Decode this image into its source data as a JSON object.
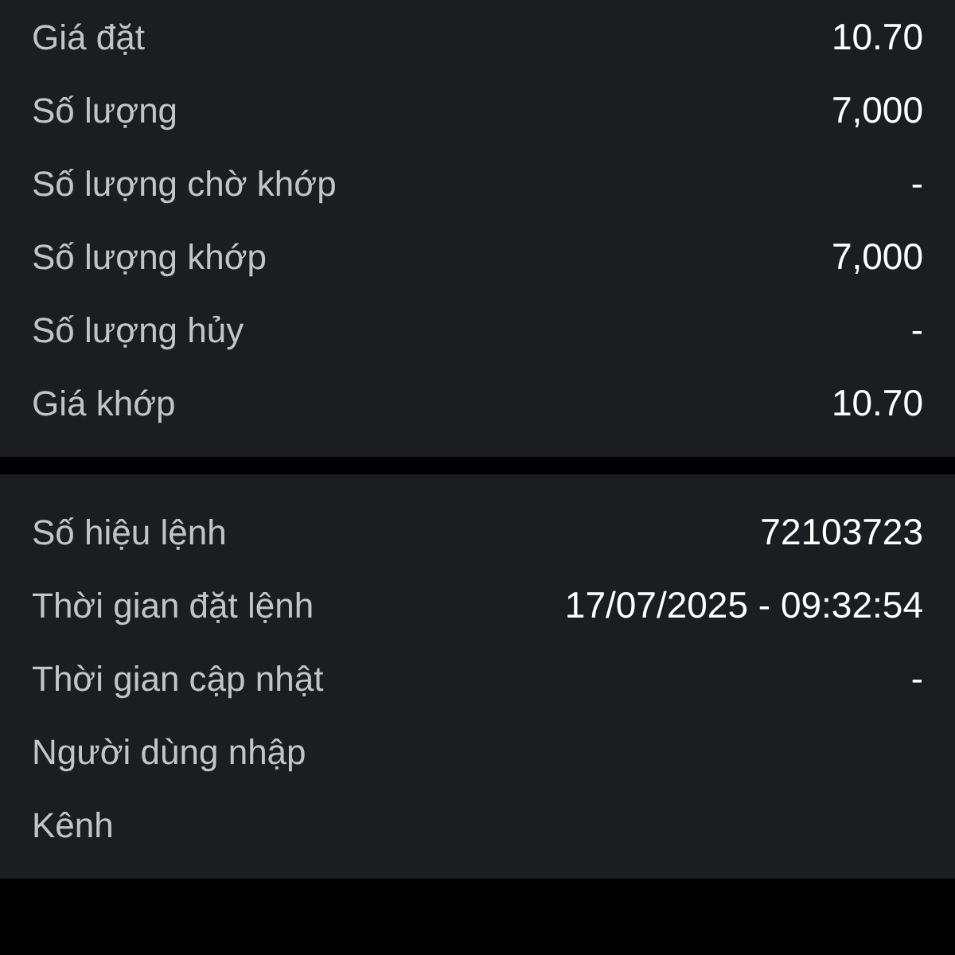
{
  "sections": [
    {
      "rows": [
        {
          "label": "Giá đặt",
          "value": "10.70"
        },
        {
          "label": "Số lượng",
          "value": "7,000"
        },
        {
          "label": "Số lượng chờ khớp",
          "value": "-"
        },
        {
          "label": "Số lượng khớp",
          "value": "7,000"
        },
        {
          "label": "Số lượng hủy",
          "value": "-"
        },
        {
          "label": "Giá khớp",
          "value": "10.70"
        }
      ]
    },
    {
      "rows": [
        {
          "label": "Số hiệu lệnh",
          "value": "72103723"
        },
        {
          "label": "Thời gian đặt lệnh",
          "value": "17/07/2025 - 09:32:54"
        },
        {
          "label": "Thời gian cập nhật",
          "value": "-"
        },
        {
          "label": "Người dùng nhập"
        },
        {
          "label": "Kênh"
        }
      ]
    }
  ]
}
